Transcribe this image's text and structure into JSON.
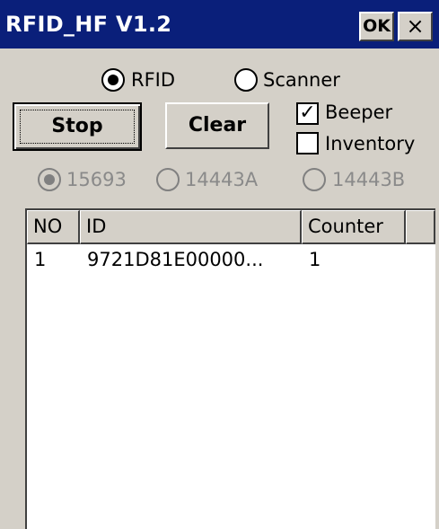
{
  "window": {
    "title": "RFID_HF V1.2",
    "ok_label": "OK",
    "close_label": "×"
  },
  "mode": {
    "options": [
      {
        "label": "RFID",
        "checked": true
      },
      {
        "label": "Scanner",
        "checked": false
      }
    ]
  },
  "buttons": {
    "stop_label": "Stop",
    "clear_label": "Clear"
  },
  "checkboxes": {
    "beeper": {
      "label": "Beeper",
      "checked": true,
      "mark": "✓"
    },
    "inventory": {
      "label": "Inventory",
      "checked": false
    }
  },
  "protocol": {
    "enabled": false,
    "options": [
      {
        "label": "15693",
        "checked": true
      },
      {
        "label": "14443A",
        "checked": false
      },
      {
        "label": "14443B",
        "checked": false
      }
    ]
  },
  "table": {
    "columns": [
      "NO",
      "ID",
      "Counter",
      ""
    ],
    "rows": [
      {
        "no": "1",
        "id": "9721D81E00000...",
        "counter": "1"
      }
    ]
  },
  "colors": {
    "titlebar": "#0a1f7a",
    "face": "#d4d0c8",
    "disabled_text": "#8a8a8a"
  }
}
